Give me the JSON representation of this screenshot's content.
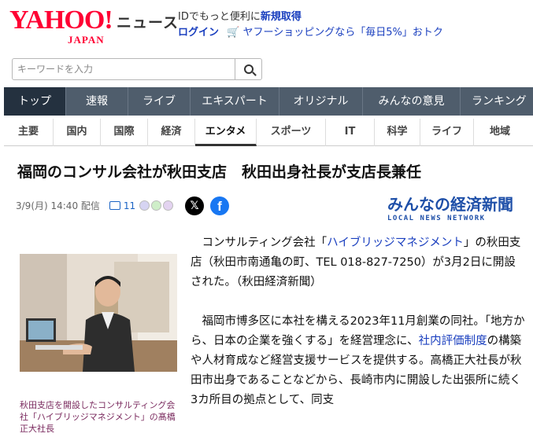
{
  "header": {
    "logo_text": "YAHOO!",
    "logo_sub": "JAPAN",
    "service": "ニュース",
    "promo_line1_prefix": "IDでもっと便利に",
    "promo_line1_link": "新規取得",
    "promo_login": "ログイン",
    "promo_shop": "ヤフーショッピングなら「毎日5%」おトク"
  },
  "search": {
    "placeholder": "キーワードを入力"
  },
  "nav": {
    "items": [
      "トップ",
      "速報",
      "ライブ",
      "エキスパート",
      "オリジナル",
      "みんなの意見",
      "ランキング"
    ]
  },
  "categories": {
    "items": [
      "主要",
      "国内",
      "国際",
      "経済",
      "エンタメ",
      "スポーツ",
      "IT",
      "科学",
      "ライフ",
      "地域"
    ]
  },
  "article": {
    "title": "福岡のコンサル会社が秋田支店　秋田出身社長が支店長兼任",
    "datetime": "3/9(月) 14:40 配信",
    "comment_count": "11",
    "source_name": "みんなの経済新聞",
    "source_sub": "LOCAL NEWS NETWORK",
    "caption": "秋田支店を開設したコンサルティング会社「ハイブリッジマネジメント」の髙橋正大社長",
    "p1_a": "コンサルティング会社「",
    "p1_link": "ハイブリッジマネジメント",
    "p1_b": "」の秋田支店（秋田市南通亀の町、TEL 018-827-7250）が3月2日に開設された。（秋田経済新聞）",
    "p2_a": "福岡市博多区に本社を構える2023年11月創業の同社。「地方から、日本の企業を強くする」を経営理念に、",
    "p2_link": "社内評価制度",
    "p2_b": "の構築や人材育成など経営支援サービスを提供する。高橋正大社長が秋田市出身であることなどから、長崎市内に開設した出張所に続く3カ所目の拠点として、同支"
  },
  "colors": {
    "brand": "#ff0033",
    "nav_bg": "#4f5d6c",
    "nav_active": "#24313f",
    "link": "#1a3fbf",
    "caption": "#7a2a5e"
  }
}
